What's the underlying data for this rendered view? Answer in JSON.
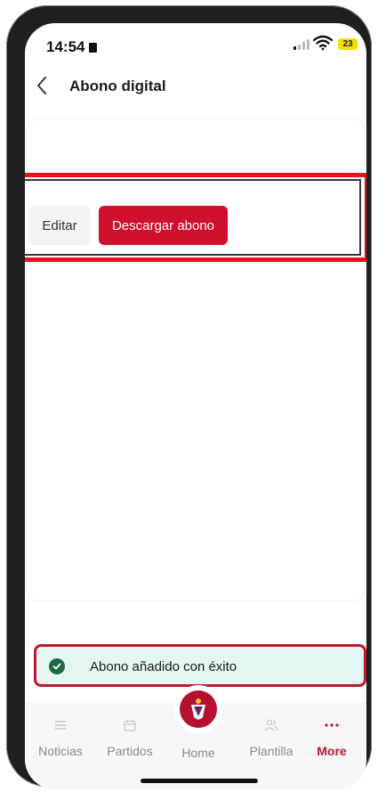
{
  "status_bar": {
    "time": "14:54",
    "battery": "23"
  },
  "header": {
    "title": "Abono digital"
  },
  "actions": {
    "edit_label": "Editar",
    "download_label": "Descargar abono"
  },
  "toast": {
    "message": "Abono añadido con éxito"
  },
  "bottom_nav": {
    "items": [
      {
        "label": "Noticias",
        "icon": "list-icon"
      },
      {
        "label": "Partidos",
        "icon": "calendar-icon"
      },
      {
        "label": "Home",
        "icon": "club-crest-icon"
      },
      {
        "label": "Plantilla",
        "icon": "people-icon"
      },
      {
        "label": "More",
        "icon": "more-dots-icon"
      }
    ],
    "active": "More"
  },
  "colors": {
    "primary": "#cf102d",
    "toast_bg": "#e3f7f0",
    "success": "#1e6b43"
  }
}
